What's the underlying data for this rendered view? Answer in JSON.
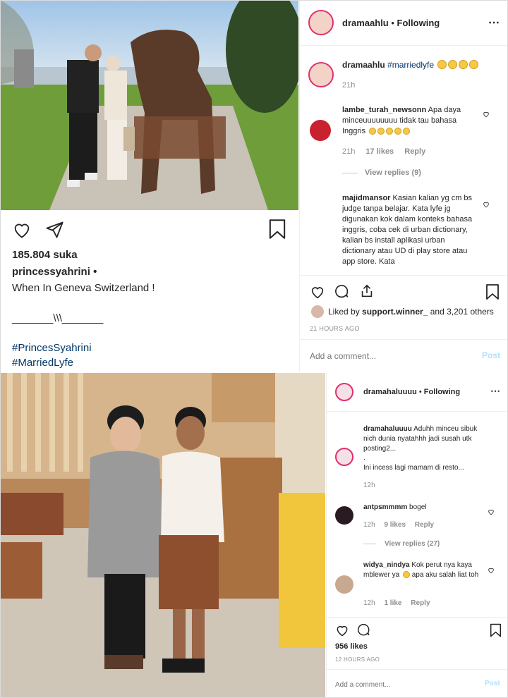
{
  "post1": {
    "account": "dramaahlu",
    "following": "Following",
    "caption_user": "dramaahlu",
    "caption_tag": "#marriedlyfe",
    "caption_time": "21h",
    "comments": [
      {
        "user": "lambe_turah_newsonn",
        "text": "Apa daya minceuuuuuuuu tidak tau bahasa Inggris",
        "time": "21h",
        "likes": "17 likes",
        "reply": "Reply",
        "view_replies": "View replies (9)"
      },
      {
        "user": "majidmansor",
        "text": "Kasian kalian yg cm bs judge tanpa belajar. Kata lyfe jg digunakan kok dalam konteks bahasa inggris, coba cek di urban dictionary, kalian bs install aplikasi urban dictionary atau UD di play store atau app store. Kata"
      }
    ],
    "liked_by_prefix": "Liked by",
    "liked_by_user": "support.winner_",
    "liked_by_suffix": "and 3,201 others",
    "time_ago": "21 HOURS AGO",
    "add_comment_placeholder": "Add a comment...",
    "post_button": "Post"
  },
  "left_post": {
    "likes": "185.804 suka",
    "user": "princessyahrini",
    "dot": "•",
    "caption": "When In Geneva Switzerland !",
    "separator": "_______\\\\\\_______",
    "tag1": "#PrincesSyahrini",
    "tag2": "#MarriedLyfe"
  },
  "post2": {
    "account": "dramahaluuuu",
    "following": "Following",
    "caption_user": "dramahaluuuu",
    "caption_text": "Aduhh minceu sibuk nich dunia nyatahhh jadi susah utk posting2...",
    "caption_dot": ".",
    "caption_text2": "Ini incess lagi mamam di resto...",
    "caption_time": "12h",
    "comments": [
      {
        "user": "antpsmmmm",
        "text": "bogel",
        "time": "12h",
        "likes": "9 likes",
        "reply": "Reply",
        "view_replies": "View replies (27)"
      },
      {
        "user": "widya_nindya",
        "text": "Kok perut nya kaya mblewer ya",
        "text2": "apa aku salah liat toh",
        "time": "12h",
        "likes": "1 like",
        "reply": "Reply"
      }
    ],
    "likes": "956 likes",
    "time_ago": "12 HOURS AGO",
    "add_comment_placeholder": "Add a comment...",
    "post_button": "Post"
  },
  "icons": [
    "heart-icon",
    "comment-icon",
    "share-icon",
    "bookmark-icon",
    "more-icon"
  ],
  "colors": {
    "link": "#00376b",
    "muted": "#8e8e8e",
    "post_button": "#b2dffc",
    "story_ring": "#e1306c"
  }
}
